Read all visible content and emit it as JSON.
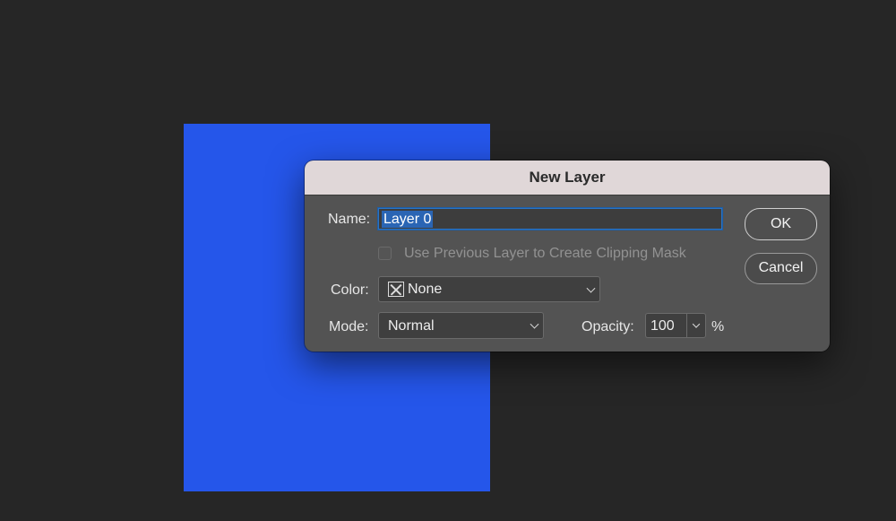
{
  "document": {
    "canvas_color": "#2556ea"
  },
  "dialog": {
    "title": "New Layer",
    "name_label": "Name:",
    "name_value": "Layer 0",
    "clipping_checkbox_label": "Use Previous Layer to Create Clipping Mask",
    "clipping_checked": false,
    "color_label": "Color:",
    "color_value": "None",
    "color_swatch_icon": "none-swatch-icon",
    "mode_label": "Mode:",
    "mode_value": "Normal",
    "opacity_label": "Opacity:",
    "opacity_value": "100",
    "opacity_unit": "%",
    "ok_label": "OK",
    "cancel_label": "Cancel"
  },
  "colors": {
    "background": "#262626",
    "dialog_body": "#535353",
    "titlebar": "#e0d7d8",
    "selection": "#2a65b4"
  }
}
